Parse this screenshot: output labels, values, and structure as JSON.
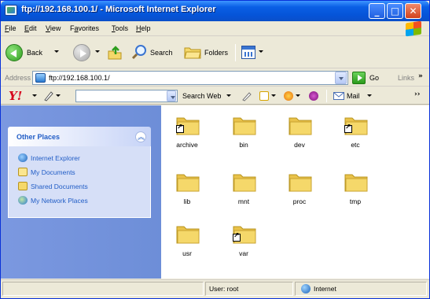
{
  "window": {
    "title": "ftp://192.168.100.1/ - Microsoft Internet Explorer",
    "controls": {
      "minimize": "_",
      "maximize": "□",
      "close": "✕"
    }
  },
  "menu": [
    "File",
    "Edit",
    "View",
    "Favorites",
    "Tools",
    "Help"
  ],
  "menu_mnemonics": [
    "F",
    "E",
    "V",
    "a",
    "T",
    "H"
  ],
  "toolbar": {
    "back": "Back",
    "search": "Search",
    "folders": "Folders"
  },
  "address": {
    "label": "Address",
    "value": "ftp://192.168.100.1/",
    "go": "Go",
    "links": "Links",
    "links_chevron": "»"
  },
  "yahoo": {
    "logo": "Y!",
    "search_web": "Search Web",
    "mail": "Mail",
    "chevron": "››"
  },
  "left_pane": {
    "section_title": "Other Places",
    "items": [
      {
        "label": "Internet Explorer",
        "icon": "internet-explorer-icon"
      },
      {
        "label": "My Documents",
        "icon": "my-documents-icon"
      },
      {
        "label": "Shared Documents",
        "icon": "shared-documents-icon"
      },
      {
        "label": "My Network Places",
        "icon": "network-places-icon"
      }
    ]
  },
  "folders": [
    {
      "name": "archive",
      "shortcut": true
    },
    {
      "name": "bin",
      "shortcut": false
    },
    {
      "name": "dev",
      "shortcut": false
    },
    {
      "name": "etc",
      "shortcut": true
    },
    {
      "name": "lib",
      "shortcut": false
    },
    {
      "name": "mnt",
      "shortcut": false
    },
    {
      "name": "proc",
      "shortcut": false
    },
    {
      "name": "tmp",
      "shortcut": false
    },
    {
      "name": "usr",
      "shortcut": false
    },
    {
      "name": "var",
      "shortcut": true
    }
  ],
  "status": {
    "user": "User: root",
    "zone": "Internet"
  },
  "colors": {
    "title_bar": "#0554d8",
    "left_pane": "#7b98e0",
    "link_blue": "#215dc6",
    "folder_yellow": "#f5d86a"
  }
}
